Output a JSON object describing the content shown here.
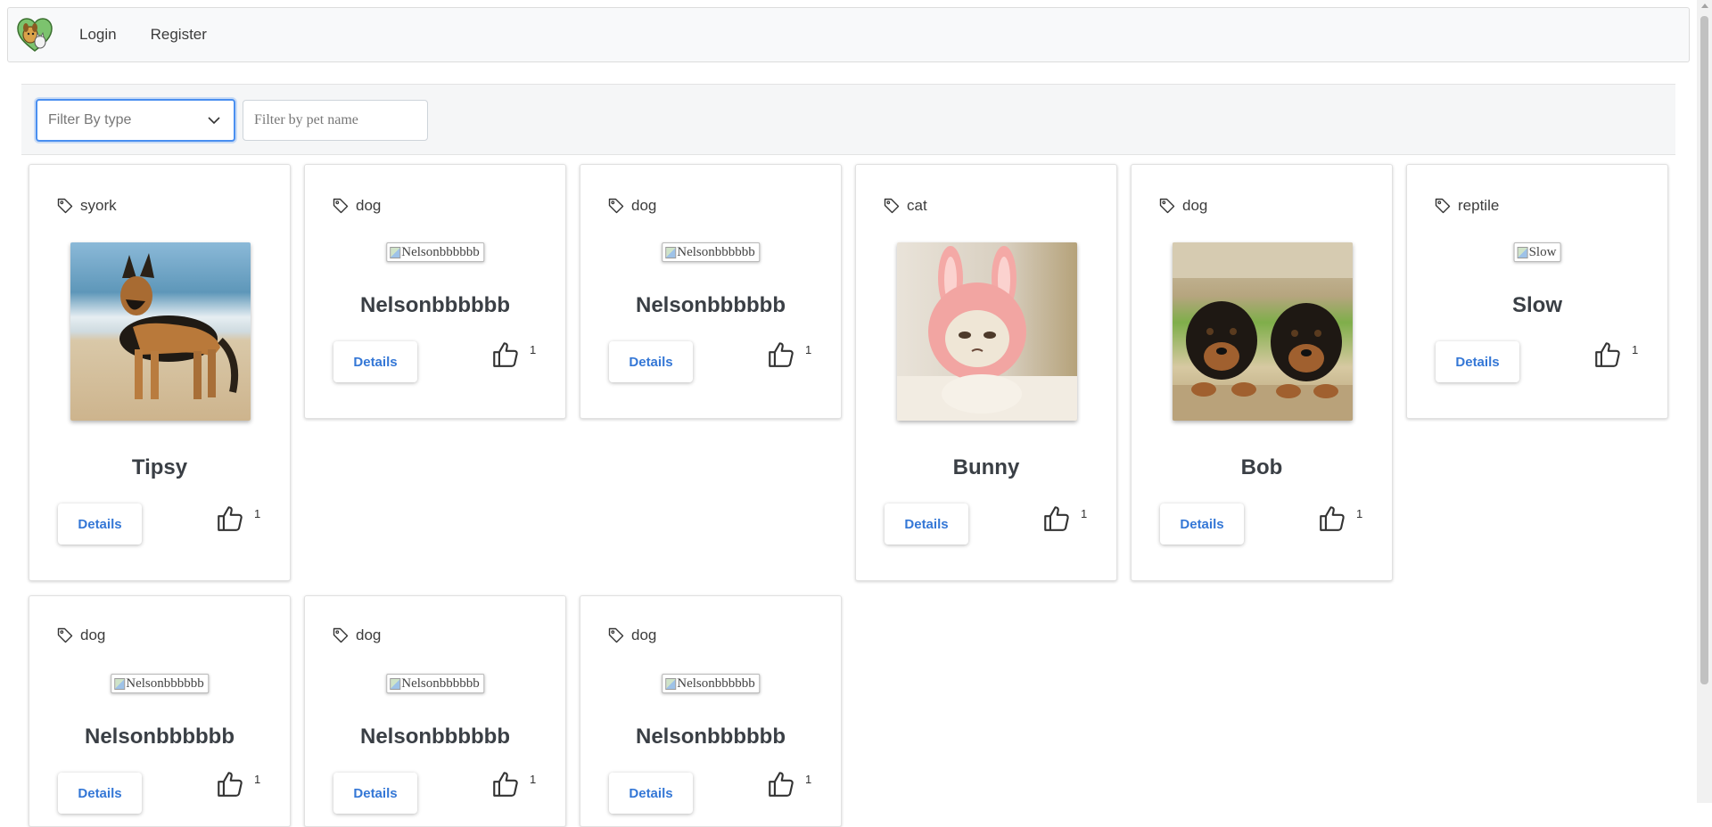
{
  "nav": {
    "login": "Login",
    "register": "Register"
  },
  "filters": {
    "type_placeholder": "Filter By type",
    "name_placeholder": "Filter by pet name"
  },
  "cards": [
    {
      "type": "syork",
      "name": "Tipsy",
      "image": "photo",
      "likes": "1",
      "details": "Details"
    },
    {
      "type": "dog",
      "name": "Nelsonbbbbbb",
      "image": "broken",
      "alt": "Nelsonbbbbbb",
      "likes": "1",
      "details": "Details"
    },
    {
      "type": "dog",
      "name": "Nelsonbbbbbb",
      "image": "broken",
      "alt": "Nelsonbbbbbb",
      "likes": "1",
      "details": "Details"
    },
    {
      "type": "cat",
      "name": "Bunny",
      "image": "photo",
      "likes": "1",
      "details": "Details"
    },
    {
      "type": "dog",
      "name": "Bob",
      "image": "photo",
      "likes": "1",
      "details": "Details"
    },
    {
      "type": "reptile",
      "name": "Slow",
      "image": "broken",
      "alt": "Slow",
      "likes": "1",
      "details": "Details"
    },
    {
      "type": "dog",
      "name": "Nelsonbbbbbb",
      "image": "broken",
      "alt": "Nelsonbbbbbb",
      "likes": "1",
      "details": "Details"
    },
    {
      "type": "dog",
      "name": "Nelsonbbbbbb",
      "image": "broken",
      "alt": "Nelsonbbbbbb",
      "likes": "1",
      "details": "Details"
    },
    {
      "type": "dog",
      "name": "Nelsonbbbbbb",
      "image": "broken",
      "alt": "Nelsonbbbbbb",
      "likes": "1",
      "details": "Details"
    }
  ],
  "colors": {
    "accent": "#3477d6",
    "focus": "#4a8ff0",
    "navbar_bg": "#f8f9fa"
  },
  "icons": {
    "tag": "tag-icon",
    "like": "thumbs-up-icon",
    "dropdown": "chevron-down-icon",
    "logo": "pet-logo-icon"
  }
}
